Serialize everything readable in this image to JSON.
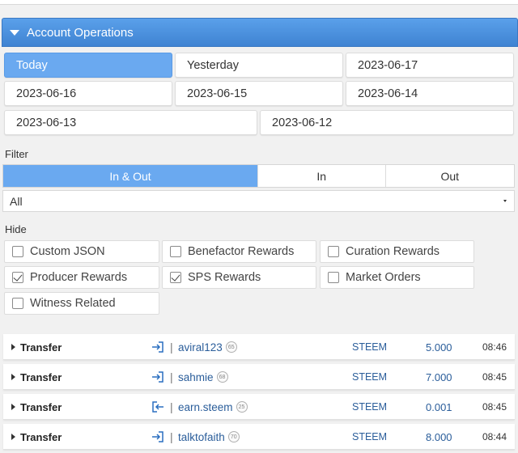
{
  "section": {
    "title": "Account Operations"
  },
  "dates": [
    "Today",
    "Yesterday",
    "2023-06-17",
    "2023-06-16",
    "2023-06-15",
    "2023-06-14",
    "2023-06-13",
    "2023-06-12"
  ],
  "active_date": "Today",
  "filter": {
    "label": "Filter",
    "segments": [
      "In & Out",
      "In",
      "Out"
    ],
    "active": "In & Out",
    "select_value": "All"
  },
  "hide": {
    "label": "Hide",
    "options": [
      {
        "label": "Custom JSON",
        "checked": false
      },
      {
        "label": "Benefactor Rewards",
        "checked": false
      },
      {
        "label": "Curation Rewards",
        "checked": false
      },
      {
        "label": "Producer Rewards",
        "checked": true
      },
      {
        "label": "SPS Rewards",
        "checked": true
      },
      {
        "label": "Market Orders",
        "checked": false
      },
      {
        "label": "Witness Related",
        "checked": false
      }
    ]
  },
  "operations": [
    {
      "type": "Transfer",
      "direction": "in",
      "account": "aviral123",
      "reputation": "65",
      "asset": "STEEM",
      "amount": "5.000",
      "time": "08:46"
    },
    {
      "type": "Transfer",
      "direction": "in",
      "account": "sahmie",
      "reputation": "68",
      "asset": "STEEM",
      "amount": "7.000",
      "time": "08:45"
    },
    {
      "type": "Transfer",
      "direction": "out",
      "account": "earn.steem",
      "reputation": "25",
      "asset": "STEEM",
      "amount": "0.001",
      "time": "08:45"
    },
    {
      "type": "Transfer",
      "direction": "in",
      "account": "talktofaith",
      "reputation": "70",
      "asset": "STEEM",
      "amount": "8.000",
      "time": "08:44"
    }
  ],
  "colors": {
    "accent": "#4a90d9",
    "active_button": "#6aa9f0",
    "link": "#2a5d9a"
  }
}
